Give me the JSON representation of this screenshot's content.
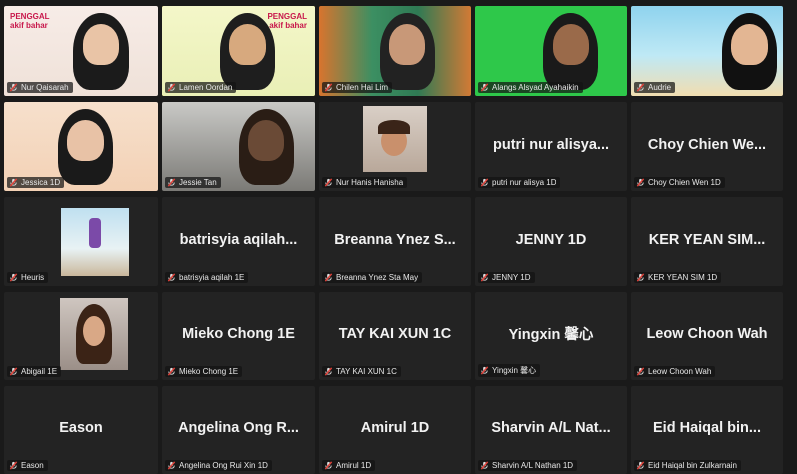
{
  "participants": [
    {
      "label": "Nur Qaisarah",
      "big_name": "",
      "video": "pink"
    },
    {
      "label": "Lamen Oordan",
      "big_name": "",
      "video": "yellow"
    },
    {
      "label": "Chilen Hai Lim",
      "big_name": "",
      "video": "class"
    },
    {
      "label": "Alangs Alsyad Ayahaikin",
      "big_name": "",
      "video": "green"
    },
    {
      "label": "Audrie",
      "big_name": "",
      "video": "beach"
    },
    {
      "label": "Jessica 1D",
      "big_name": "",
      "video": "burger"
    },
    {
      "label": "Jessie Tan",
      "big_name": "",
      "video": "room"
    },
    {
      "label": "Nur Hanis Hanisha",
      "big_name": "",
      "video": "thumb-room"
    },
    {
      "label": "putri nur alisya 1D",
      "big_name": "putri nur alisya...",
      "video": ""
    },
    {
      "label": "Choy Chien Wen 1D",
      "big_name": "Choy Chien We...",
      "video": ""
    },
    {
      "label": "Heuris",
      "big_name": "",
      "video": "thumb-picture"
    },
    {
      "label": "batrisyia aqilah 1E",
      "big_name": "batrisyia aqilah...",
      "video": ""
    },
    {
      "label": "Breanna Ynez Sta May",
      "big_name": "Breanna Ynez S...",
      "video": ""
    },
    {
      "label": "JENNY 1D",
      "big_name": "JENNY 1D",
      "video": ""
    },
    {
      "label": "KER YEAN SIM 1D",
      "big_name": "KER YEAN SIM...",
      "video": ""
    },
    {
      "label": "Abigail 1E",
      "big_name": "",
      "video": "thumb-portrait"
    },
    {
      "label": "Mieko Chong 1E",
      "big_name": "Mieko Chong 1E",
      "video": ""
    },
    {
      "label": "TAY KAI XUN 1C",
      "big_name": "TAY KAI XUN 1C",
      "video": ""
    },
    {
      "label": "Yingxin 馨心",
      "big_name": "Yingxin 馨心",
      "video": ""
    },
    {
      "label": "Leow Choon Wah",
      "big_name": "Leow Choon Wah",
      "video": ""
    },
    {
      "label": "Eason",
      "big_name": "Eason",
      "video": ""
    },
    {
      "label": "Angelina Ong Rui Xin 1D",
      "big_name": "Angelina Ong R...",
      "video": ""
    },
    {
      "label": "Amirul 1D",
      "big_name": "Amirul 1D",
      "video": ""
    },
    {
      "label": "Sharvin A/L Nathan 1D",
      "big_name": "Sharvin A/L Nat...",
      "video": ""
    },
    {
      "label": "Eid Haiqal bin Zulkarnain",
      "big_name": "Eid Haiqal bin...",
      "video": ""
    }
  ],
  "stickers": {
    "left": "PENGGAL\nakif bahar",
    "right": "PENGGAL\nakif bahar"
  },
  "colors": {
    "active_speaker": "#f2c500",
    "muted_mic": "#e0423a",
    "tile_bg": "#232323"
  },
  "icons": {
    "muted": "mic-muted-icon"
  }
}
